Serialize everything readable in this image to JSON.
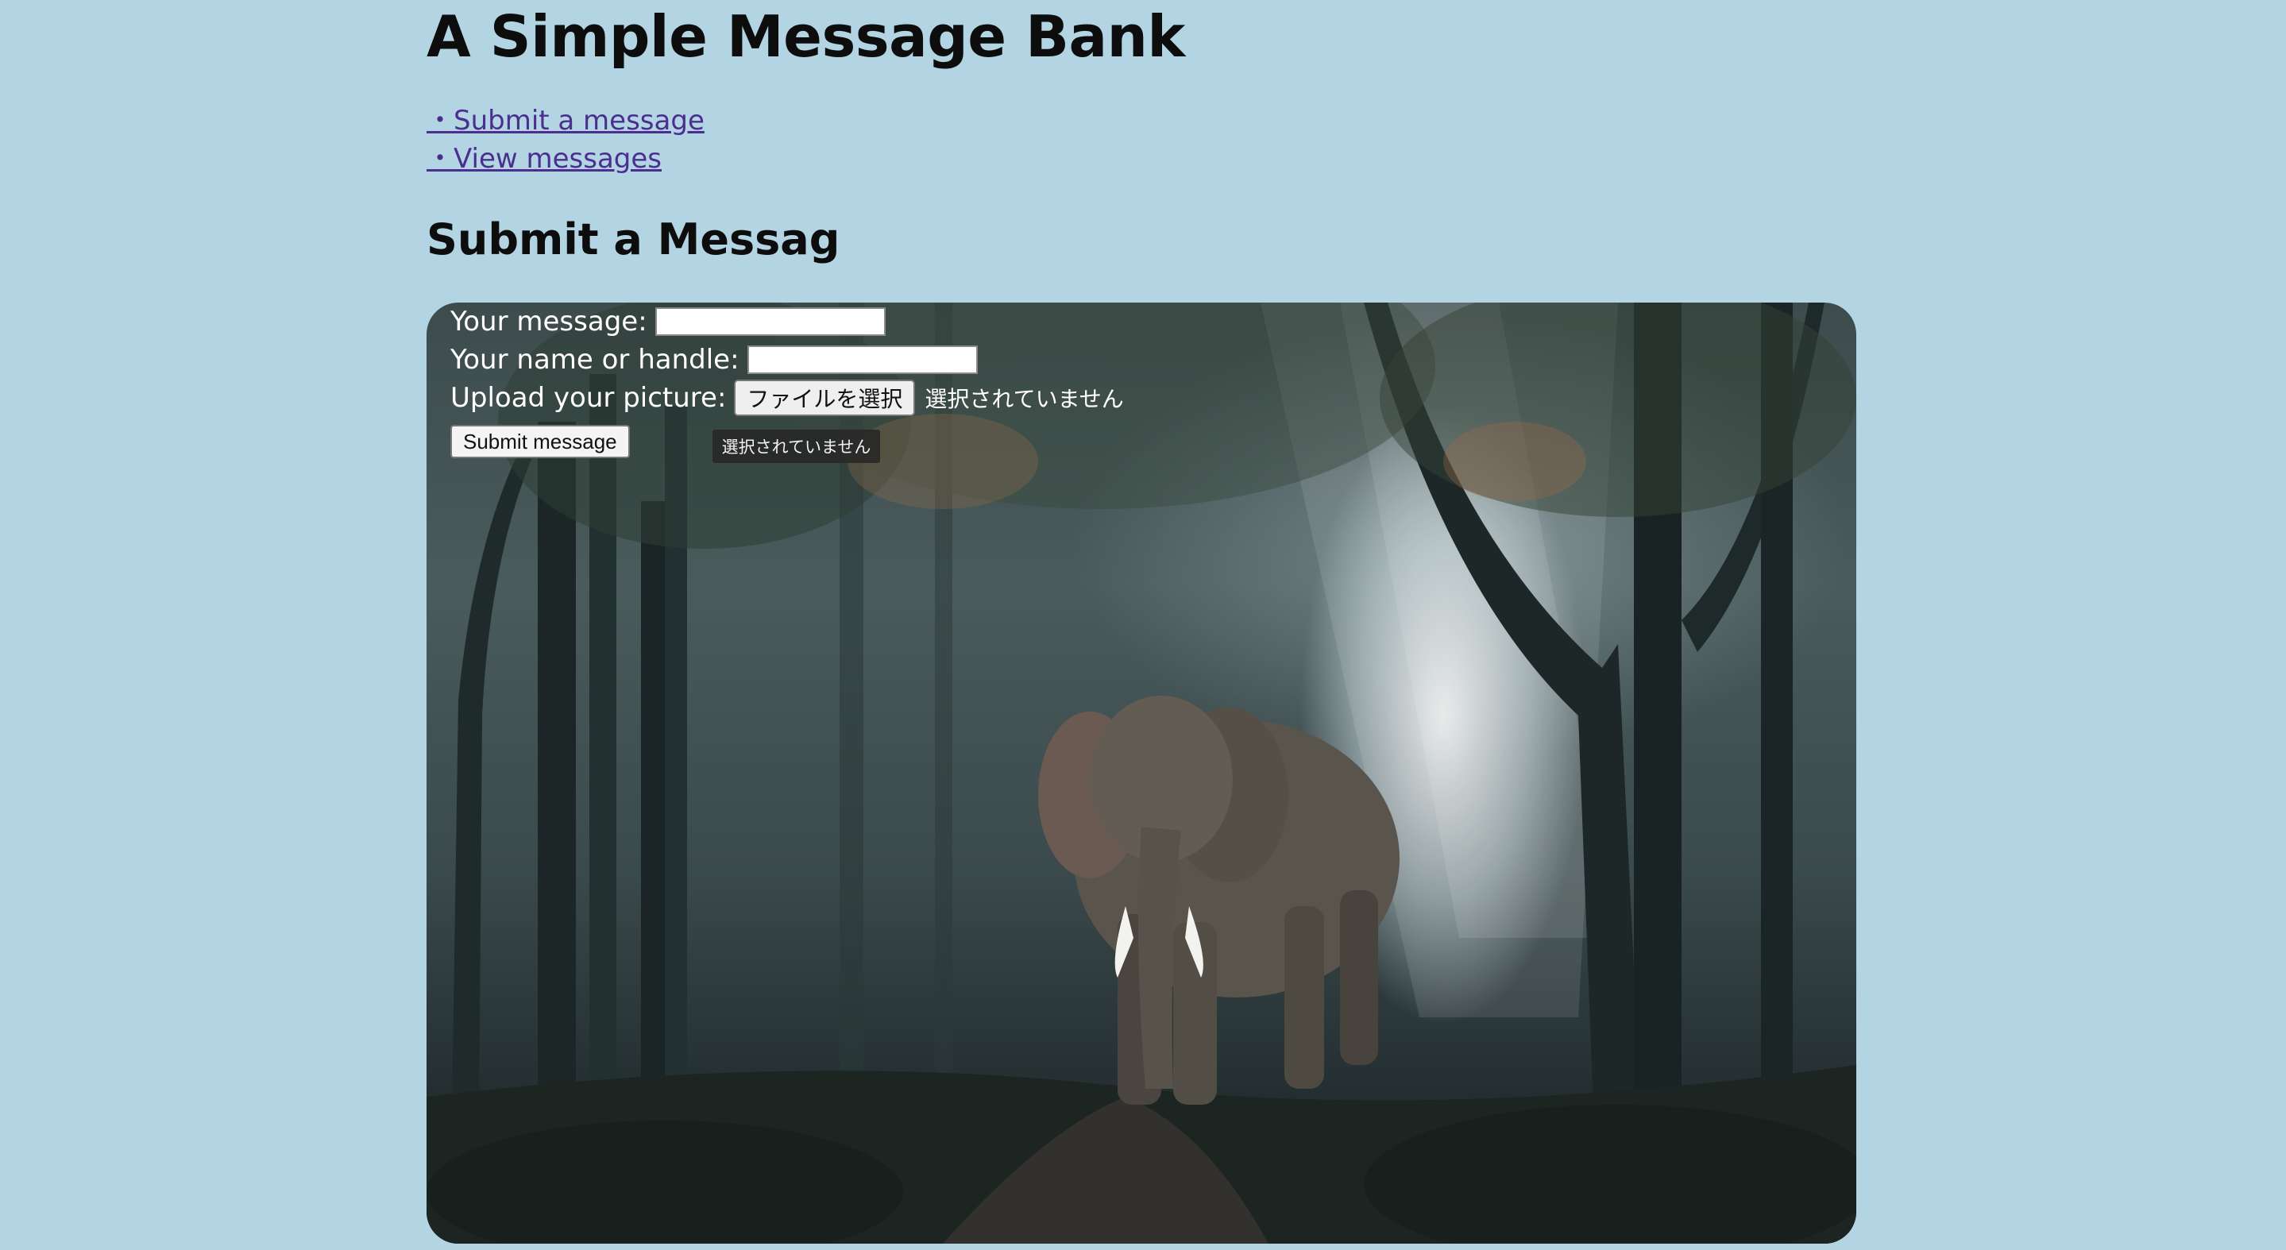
{
  "page": {
    "title": "A Simple Message Bank",
    "nav": {
      "submit_link": "・Submit a message",
      "view_link": "・View messages"
    },
    "section_heading": "Submit a Messag"
  },
  "form": {
    "message_label": "Your message:",
    "message_value": "",
    "name_label": "Your name or handle:",
    "name_value": "",
    "picture_label": "Upload your picture:",
    "file_button_label": "ファイルを選択",
    "file_status": "選択されていません",
    "submit_label": "Submit message",
    "tooltip_text": "選択されていません"
  },
  "colors": {
    "page_background": "#b3d5e3",
    "link": "#4a2f8f"
  }
}
